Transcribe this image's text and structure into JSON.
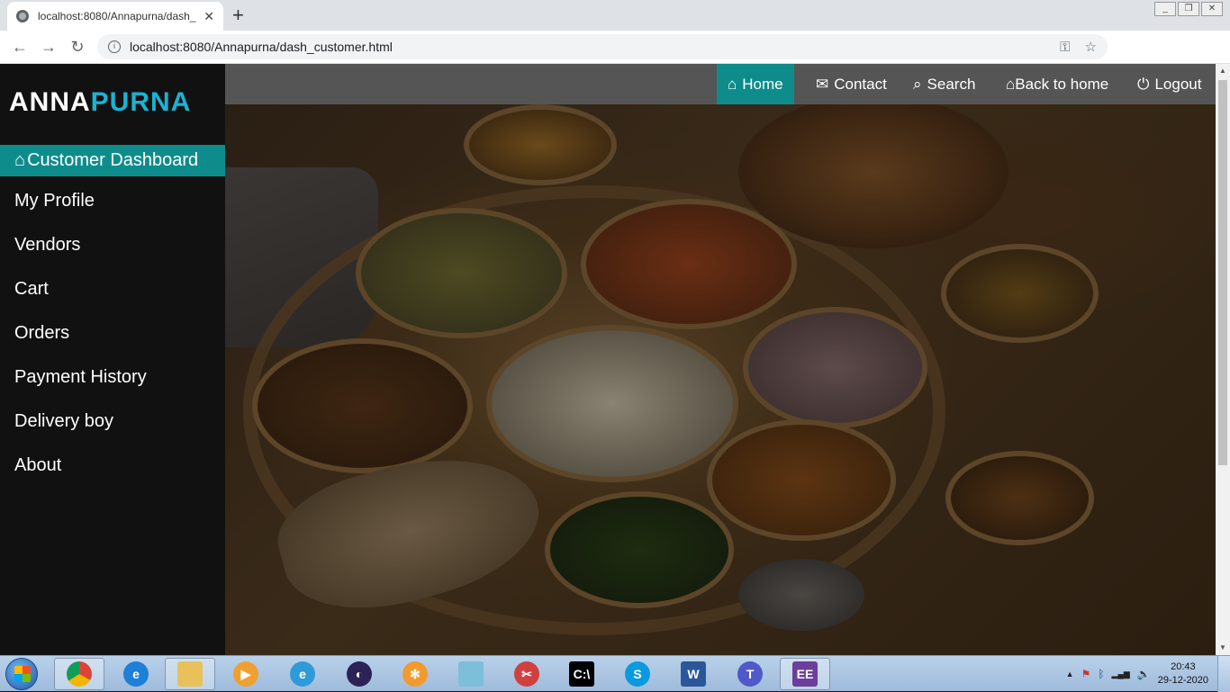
{
  "browser": {
    "tab_title": "localhost:8080/Annapurna/dash_",
    "new_tab_label": "+",
    "url": "localhost:8080/Annapurna/dash_customer.html",
    "tab_close": "✕",
    "back": "←",
    "forward": "→",
    "reload": "↻",
    "info": "i",
    "key": "⚿",
    "star": "☆",
    "ext_puzzle": "✣",
    "profile": "●",
    "menu": "⋮",
    "win_min": "_",
    "win_max": "❐",
    "win_close": "✕"
  },
  "brand": {
    "part1": "ANNA",
    "part2": "PURNA",
    "color_part2": "#1ab3d4"
  },
  "sidebar": {
    "active": {
      "icon": "home-icon",
      "glyph": "⌂",
      "label": "Customer Dashboard"
    },
    "items": [
      {
        "label": "My Profile"
      },
      {
        "label": "Vendors"
      },
      {
        "label": "Cart"
      },
      {
        "label": "Orders"
      },
      {
        "label": "Payment History"
      },
      {
        "label": "Delivery boy"
      },
      {
        "label": "About"
      }
    ],
    "accent": "#0e8c8c"
  },
  "topnav": {
    "items": [
      {
        "glyph": "⌂",
        "icon": "home-icon",
        "label": "Home",
        "active": true
      },
      {
        "glyph": "✉",
        "icon": "envelope-icon",
        "label": "Contact"
      },
      {
        "glyph": "⌕",
        "icon": "search-icon",
        "label": "Search"
      },
      {
        "glyph": "⌂",
        "icon": "home-icon",
        "label": "Back to home"
      },
      {
        "glyph": "⏻",
        "icon": "power-icon",
        "label": "Logout"
      }
    ]
  },
  "taskbar": {
    "apps": [
      {
        "name": "chrome",
        "short": "",
        "color": "#db4437"
      },
      {
        "name": "internet-explorer",
        "short": "e",
        "color": "#1e7fd6"
      },
      {
        "name": "file-explorer",
        "short": "",
        "color": "#e8c15a"
      },
      {
        "name": "media-player",
        "short": "▶",
        "color": "#f0a030"
      },
      {
        "name": "edge",
        "short": "e",
        "color": "#2f9ad8"
      },
      {
        "name": "eclipse",
        "short": "◐",
        "color": "#2c2255"
      },
      {
        "name": "app-orange",
        "short": "✻",
        "color": "#f29a2e"
      },
      {
        "name": "notepad",
        "short": "",
        "color": "#7dbfd8"
      },
      {
        "name": "snipping-tool",
        "short": "✂",
        "color": "#d04040"
      },
      {
        "name": "cmd",
        "short": "C:\\",
        "color": "#000000"
      },
      {
        "name": "skype",
        "short": "S",
        "color": "#0a9ae0"
      },
      {
        "name": "word",
        "short": "W",
        "color": "#2b579a"
      },
      {
        "name": "teams",
        "short": "T",
        "color": "#5059c9"
      },
      {
        "name": "java-ee-ide",
        "short": "EE",
        "color": "#6b3f9b"
      }
    ],
    "tray": {
      "up_arrow": "▲",
      "flag": "⚑",
      "bluetooth": "ᛒ",
      "signal": "▂▄▆",
      "volume": "🔈"
    },
    "time": "20:43",
    "date": "29-12-2020"
  }
}
